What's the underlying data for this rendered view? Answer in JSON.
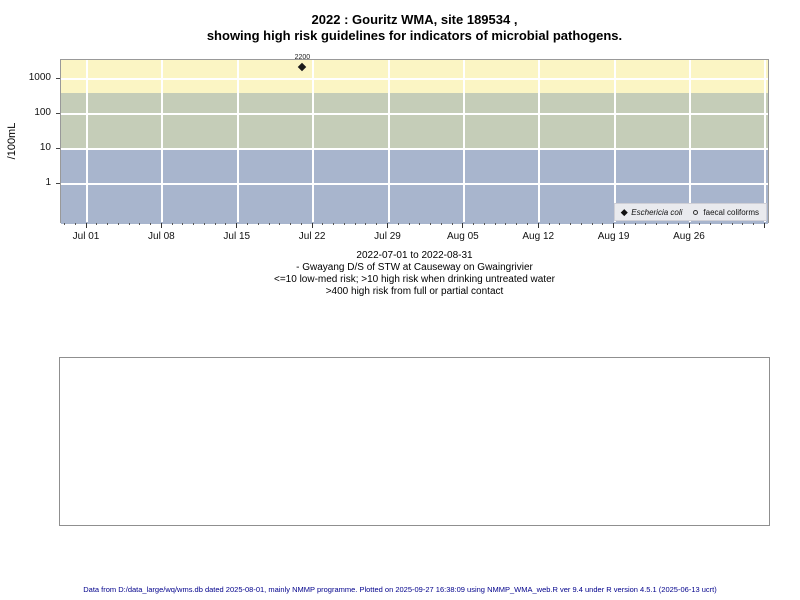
{
  "title": {
    "line1": "2022 : Gouritz WMA, site 189534 ,",
    "line2": "showing high risk guidelines for indicators of microbial pathogens."
  },
  "chart_data": {
    "type": "scatter",
    "title": "2022 : Gouritz WMA, site 189534 , showing high risk guidelines for indicators of microbial pathogens.",
    "ylabel": "/100mL",
    "xlabel": "",
    "yscale": "log",
    "ylim": [
      0.07,
      3500
    ],
    "y_ticks": [
      1,
      10,
      100,
      1000
    ],
    "x_tick_labels": [
      "Jul 01",
      "Jul 08",
      "Jul 15",
      "Jul 22",
      "Jul 29",
      "Aug 05",
      "Aug 12",
      "Aug 19",
      "Aug 26"
    ],
    "x_tick_day_offsets": [
      0,
      7,
      14,
      21,
      28,
      35,
      42,
      49,
      56
    ],
    "x_extra_gridline_days": [
      63
    ],
    "x_minor_tick_day_range": [
      -2,
      63
    ],
    "grid": "white weekly vertical and decade horizontal lines",
    "bands": [
      {
        "name": "low-med-risk-band",
        "from": 0.07,
        "to": 10,
        "color": "#A8B5CD"
      },
      {
        "name": "high-risk-drinking-band",
        "from": 10,
        "to": 400,
        "color": "#C5CDB8"
      },
      {
        "name": "high-risk-contact-band",
        "from": 400,
        "to": 3500,
        "color": "#FBF5C4"
      }
    ],
    "series": [
      {
        "name": "Eschericia coli",
        "marker": "filled-diamond",
        "points": [
          {
            "day_offset_from_jul01": 20,
            "value": 2200,
            "label": "2200"
          }
        ]
      },
      {
        "name": "faecal coliforms",
        "marker": "open-circle",
        "points": []
      }
    ],
    "legend": {
      "position": "bottom-right",
      "entries": [
        {
          "marker": "filled-diamond",
          "label": "Eschericia coli",
          "italic": true
        },
        {
          "marker": "open-circle",
          "label": "faecal coliforms",
          "italic": false
        }
      ]
    }
  },
  "caption": {
    "lines": [
      "2022-07-01 to 2022-08-31",
      "- Gwayang D/S of STW at Causeway on Gwaingrivier",
      "<=10 low-med risk; >10 high risk when drinking untreated water",
      ">400 high risk from full or partial contact"
    ]
  },
  "footer": {
    "text": "Data from D:/data_large/wq/wms.db dated 2025-08-01, mainly NMMP programme. Plotted on 2025-09-27 16:38:09 using NMMP_WMA_web.R ver 9.4 under R version 4.5.1 (2025-06-13 ucrt)",
    "color": "#00008B"
  }
}
